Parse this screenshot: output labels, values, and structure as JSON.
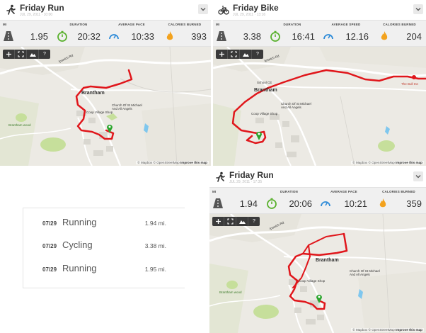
{
  "cards": [
    {
      "id": "card1",
      "activity_icon": "runner-icon",
      "title": "Friday Run",
      "date": "JUL 29, 2011 · 10:00",
      "stats": {
        "distance": {
          "label": "MI",
          "value": "1.95",
          "icon": "road-icon"
        },
        "duration": {
          "label": "DURATION",
          "value": "20:32",
          "icon": "stopwatch-icon"
        },
        "speed": {
          "label": "AVERAGE PACE",
          "value": "10:33",
          "icon": "speedometer-icon"
        },
        "calories": {
          "label": "CALORIES BURNED",
          "value": "393",
          "icon": "flame-icon"
        }
      },
      "map": {
        "town": "Brantham",
        "church": "Church Of St Michael And All Angels",
        "shop": "Coop Village Shop",
        "wood": "Brantham wood",
        "road": "Ipswich Rd"
      }
    },
    {
      "id": "card2",
      "activity_icon": "bicycle-icon",
      "title": "Friday Bike",
      "date": "JUL 29, 2011 · 13:16",
      "stats": {
        "distance": {
          "label": "MI",
          "value": "3.38",
          "icon": "road-icon"
        },
        "duration": {
          "label": "DURATION",
          "value": "16:41",
          "icon": "stopwatch-icon"
        },
        "speed": {
          "label": "AVERAGE SPEED",
          "value": "12.16",
          "icon": "speedometer-icon"
        },
        "calories": {
          "label": "CALORIES BURNED",
          "value": "204",
          "icon": "flame-icon"
        }
      },
      "map": {
        "town": "Brantham",
        "church": "Church Of St Michael And All Angels",
        "shop": "Coop Village Shop",
        "school": "School CE",
        "pub": "The Bull Inn",
        "road": "Ipswich Rd"
      }
    },
    {
      "id": "card3",
      "activity_icon": "runner-icon",
      "title": "Friday Run",
      "date": "JUL 29, 2011 · 17:35",
      "stats": {
        "distance": {
          "label": "MI",
          "value": "1.94",
          "icon": "road-icon"
        },
        "duration": {
          "label": "DURATION",
          "value": "20:06",
          "icon": "stopwatch-icon"
        },
        "speed": {
          "label": "AVERAGE PACE",
          "value": "10:21",
          "icon": "speedometer-icon"
        },
        "calories": {
          "label": "CALORIES BURNED",
          "value": "359",
          "icon": "flame-icon"
        }
      },
      "map": {
        "town": "Brantham",
        "church": "Church Of St Michael And All Angels",
        "shop": "Coop Village Shop",
        "wood": "Brantham wood",
        "road": "Ipswich Rd"
      }
    }
  ],
  "map_controls": {
    "help": "?"
  },
  "attribution": {
    "mapbox": "© Mapbox",
    "osm": "© OpenStreetMap",
    "improve": "Improve this map"
  },
  "recent": [
    {
      "date": "07/29",
      "type": "Running",
      "distance": "1.94 mi."
    },
    {
      "date": "07/29",
      "type": "Cycling",
      "distance": "3.38 mi."
    },
    {
      "date": "07/29",
      "type": "Running",
      "distance": "1.95 mi."
    }
  ],
  "colors": {
    "route": "#e0161b",
    "start_marker": "#2aa52c",
    "end_marker": "#e0161b",
    "map_bg": "#eceae4",
    "water": "#7fc7ee",
    "park": "#c6df9b",
    "accent_icon": "#f3a21d",
    "stopwatch": "#5ab12e",
    "speed": "#2e8bd8"
  }
}
